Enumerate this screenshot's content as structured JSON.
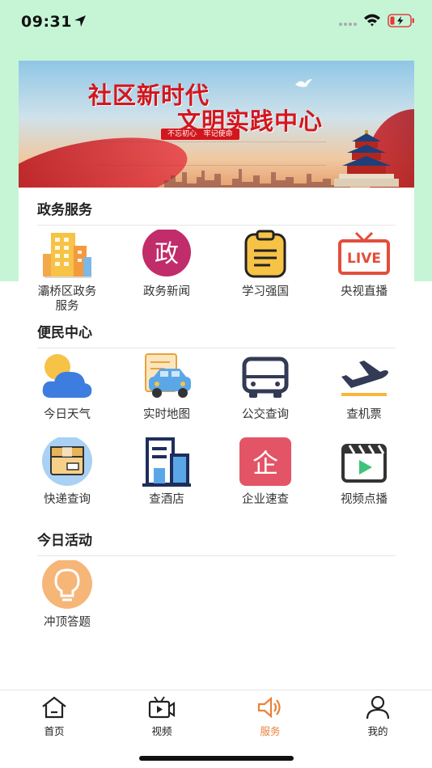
{
  "status_bar": {
    "time": "09:31"
  },
  "banner": {
    "title_line1": "社区新时代",
    "title_line2": "文明实践中心",
    "slogan": "不忘初心   牢记使命"
  },
  "sections": [
    {
      "title": "政务服务",
      "items": [
        {
          "label": "灞桥区政务\n服务",
          "icon": "office-building-icon"
        },
        {
          "label": "政务新闻",
          "icon": "government-news-icon",
          "glyph": "政"
        },
        {
          "label": "学习强国",
          "icon": "clipboard-icon"
        },
        {
          "label": "央视直播",
          "icon": "live-tv-icon",
          "glyph": "LIVE"
        }
      ]
    },
    {
      "title": "便民中心",
      "items": [
        {
          "label": "今日天气",
          "icon": "weather-icon"
        },
        {
          "label": "实时地图",
          "icon": "car-map-icon"
        },
        {
          "label": "公交查询",
          "icon": "bus-icon"
        },
        {
          "label": "查机票",
          "icon": "airplane-icon"
        },
        {
          "label": "快递查询",
          "icon": "package-icon"
        },
        {
          "label": "查酒店",
          "icon": "hotel-icon"
        },
        {
          "label": "企业速查",
          "icon": "enterprise-icon",
          "glyph": "企"
        },
        {
          "label": "视频点播",
          "icon": "video-clapper-icon"
        }
      ]
    },
    {
      "title": "今日活动",
      "items": [
        {
          "label": "冲顶答题",
          "icon": "lightbulb-icon"
        }
      ]
    }
  ],
  "tabbar": [
    {
      "label": "首页",
      "icon": "home-icon",
      "active": false
    },
    {
      "label": "视频",
      "icon": "video-icon",
      "active": false
    },
    {
      "label": "服务",
      "icon": "speaker-icon",
      "active": true
    },
    {
      "label": "我的",
      "icon": "person-icon",
      "active": false
    }
  ],
  "colors": {
    "header_bg": "#c6f5d6",
    "accent": "#e8823a",
    "banner_red": "#d3161e"
  }
}
